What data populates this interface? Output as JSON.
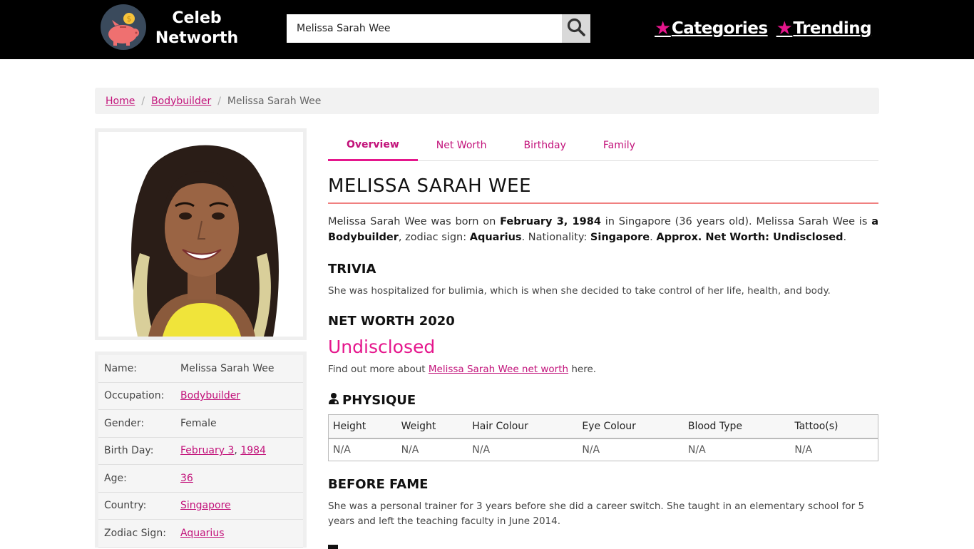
{
  "header": {
    "logo_line1": "Celeb",
    "logo_line2": "Networth",
    "search_value": "Melissa Sarah Wee",
    "nav": [
      {
        "label": "Categories"
      },
      {
        "label": "Trending"
      }
    ],
    "star_glyph": "★"
  },
  "breadcrumb": {
    "home": "Home",
    "category": "Bodybuilder",
    "current": "Melissa Sarah Wee",
    "separator": "/"
  },
  "profile": {
    "rows": [
      {
        "label": "Name:",
        "value": "Melissa Sarah Wee"
      },
      {
        "label": "Occupation:",
        "value": "Bodybuilder"
      },
      {
        "label": "Gender:",
        "value": "Female"
      },
      {
        "label": "Birth Day:",
        "value_month_day": "February 3",
        "value_sep": ", ",
        "value_year": "1984"
      },
      {
        "label": "Age:",
        "value": "36"
      },
      {
        "label": "Country:",
        "value": "Singapore"
      },
      {
        "label": "Zodiac Sign:",
        "value": "Aquarius"
      }
    ]
  },
  "tabs": [
    {
      "label": "Overview"
    },
    {
      "label": "Net Worth"
    },
    {
      "label": "Birthday"
    },
    {
      "label": "Family"
    }
  ],
  "main": {
    "title": "MELISSA SARAH WEE",
    "intro": {
      "t1": "Melissa Sarah Wee was born on ",
      "b1": "February 3, 1984",
      "t2": " in Singapore (36 years old). Melissa Sarah Wee is ",
      "b2": "a Bodybuilder",
      "t3": ", zodiac sign: ",
      "b3": "Aquarius",
      "t4": ". Nationality: ",
      "b4": "Singapore",
      "t5": ". ",
      "b5": "Approx. Net Worth: Undisclosed",
      "t6": "."
    },
    "trivia_heading": "TRIVIA",
    "trivia_text": "She was hospitalized for bulimia, which is when she decided to take control of her life, health, and body.",
    "networth_heading": "NET WORTH 2020",
    "networth_value": "Undisclosed",
    "networth_more_pre": "Find out more about ",
    "networth_more_link": "Melissa Sarah Wee net worth",
    "networth_more_post": " here.",
    "physique_heading": "PHYSIQUE",
    "physique_headers": [
      "Height",
      "Weight",
      "Hair Colour",
      "Eye Colour",
      "Blood Type",
      "Tattoo(s)"
    ],
    "physique_values": [
      "N/A",
      "N/A",
      "N/A",
      "N/A",
      "N/A",
      "N/A"
    ],
    "before_fame_heading": "BEFORE FAME",
    "before_fame_text": "She was a personal trainer for 3 years before she did a career switch. She taught in an elementary school for 5 years and left the teaching faculty in June 2014."
  },
  "colors": {
    "accent": "#e5168c",
    "link": "#c2127a",
    "header_bg": "#000000",
    "title_underline": "#f08080"
  },
  "icons": {
    "logo": "piggy-bank-icon",
    "search": "search-icon",
    "physique": "user-doctor-icon",
    "star": "star-icon"
  }
}
